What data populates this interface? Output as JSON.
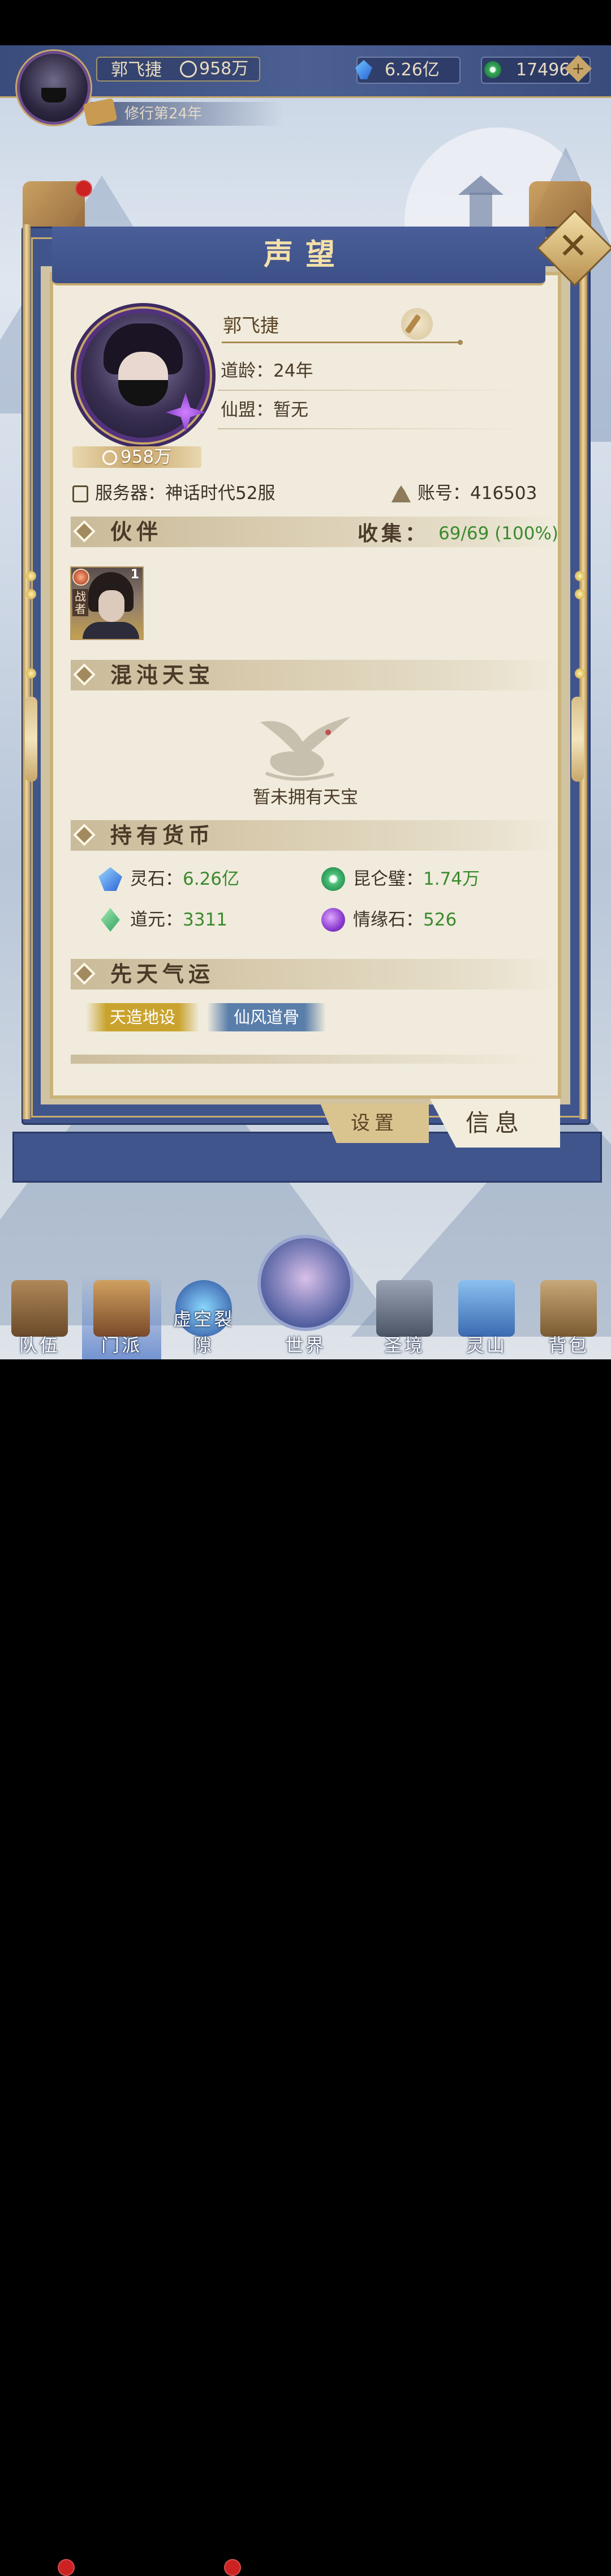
{
  "hud": {
    "player_name": "郭飞捷",
    "power": "958万",
    "spirit_stone": "6.26亿",
    "jade": "17496",
    "cultivation_year": "修行第24年",
    "plus_label": "+"
  },
  "panel": {
    "title": "声望",
    "close_label": "✕"
  },
  "profile": {
    "name": "郭飞捷",
    "dao_age_label": "道龄：",
    "dao_age_value": "24年",
    "alliance_label": "仙盟：",
    "alliance_value": "暂无",
    "power": "958万",
    "server_label": "服务器：",
    "server_value": "神话时代52服",
    "account_label": "账号：",
    "account_value": "416503"
  },
  "partners": {
    "header": "伙伴",
    "collect_label": "收集：",
    "collect_value": "69/69 (100%)",
    "cards": [
      {
        "role": "战者",
        "level": "1"
      }
    ]
  },
  "treasure": {
    "header": "混沌天宝",
    "empty_text": "暂未拥有天宝"
  },
  "currency": {
    "header": "持有货币",
    "items": [
      {
        "label": "灵石：",
        "value": "6.26亿",
        "icon": "spirit-stone-icon"
      },
      {
        "label": "昆仑璧：",
        "value": "1.74万",
        "icon": "kunlun-jade-icon"
      },
      {
        "label": "道元：",
        "value": "3311",
        "icon": "dao-essence-icon"
      },
      {
        "label": "情缘石：",
        "value": "526",
        "icon": "affinity-stone-icon"
      }
    ]
  },
  "fortune": {
    "header": "先天气运",
    "tags": [
      "天造地设",
      "仙风道骨"
    ]
  },
  "tabs": {
    "settings": "设置",
    "info": "信息"
  },
  "nav": [
    {
      "label": "队伍"
    },
    {
      "label": "门派"
    },
    {
      "label": "虚空裂隙"
    },
    {
      "label": "世界"
    },
    {
      "label": "圣境"
    },
    {
      "label": "灵山"
    },
    {
      "label": "背包"
    }
  ],
  "colors": {
    "frame_blue": "#41558d",
    "paper": "#f0ebdc",
    "gold": "#c6a86a",
    "value_green": "#3b8a2e",
    "tag_gold": "#c9a32e",
    "tag_blue": "#5a7eaa"
  }
}
